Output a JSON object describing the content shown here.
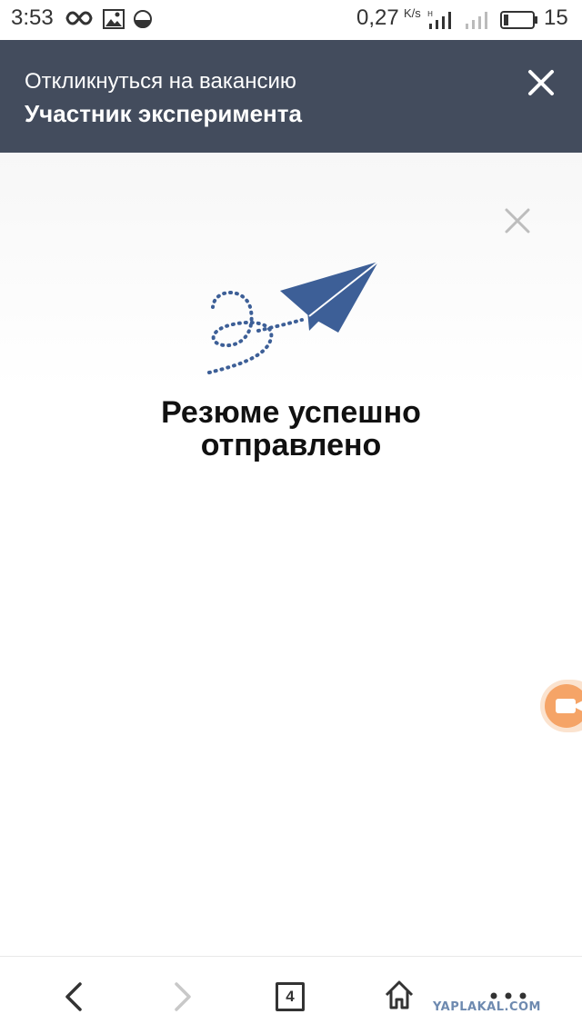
{
  "status_bar": {
    "time": "3:53",
    "network_speed": "0,27",
    "network_speed_unit": "K/s",
    "battery_level": "15",
    "icons": [
      "infinity-icon",
      "image-icon",
      "circle-half-icon",
      "signal-h-icon",
      "signal-icon",
      "battery-icon"
    ]
  },
  "header": {
    "subtitle": "Откликнуться на вакансию",
    "title": "Участник эксперимента",
    "background_color": "#434c5d"
  },
  "dialog": {
    "message": "Резюме успешно отправлено",
    "plane_color": "#3d5f97"
  },
  "bottom_nav": {
    "tabs_count": "4",
    "watermark": "YAPLAKAL.COM"
  },
  "colors": {
    "accent_orange": "#f5a467"
  }
}
